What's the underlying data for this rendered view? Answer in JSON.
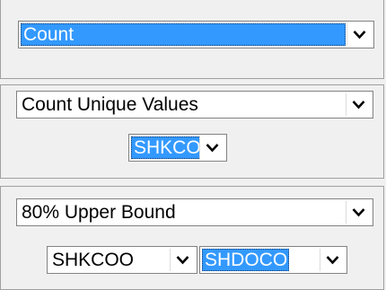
{
  "panel1": {
    "statistic_select": {
      "value": "Count",
      "selected": true
    }
  },
  "panel2": {
    "statistic_select": {
      "value": "Count Unique Values",
      "selected": false
    },
    "field_select": {
      "value": "SHKCOO",
      "selected": true
    }
  },
  "panel3": {
    "statistic_select": {
      "value": "80% Upper Bound",
      "selected": false
    },
    "field_select_1": {
      "value": "SHKCOO",
      "selected": false
    },
    "field_select_2": {
      "value": "SHDOCO",
      "selected": true
    }
  },
  "icons": {
    "dropdown_arrow": "chevron-down-icon"
  },
  "colors": {
    "selection": "#3399ff",
    "panel_bg": "#f0f0f0",
    "border": "#828282"
  }
}
